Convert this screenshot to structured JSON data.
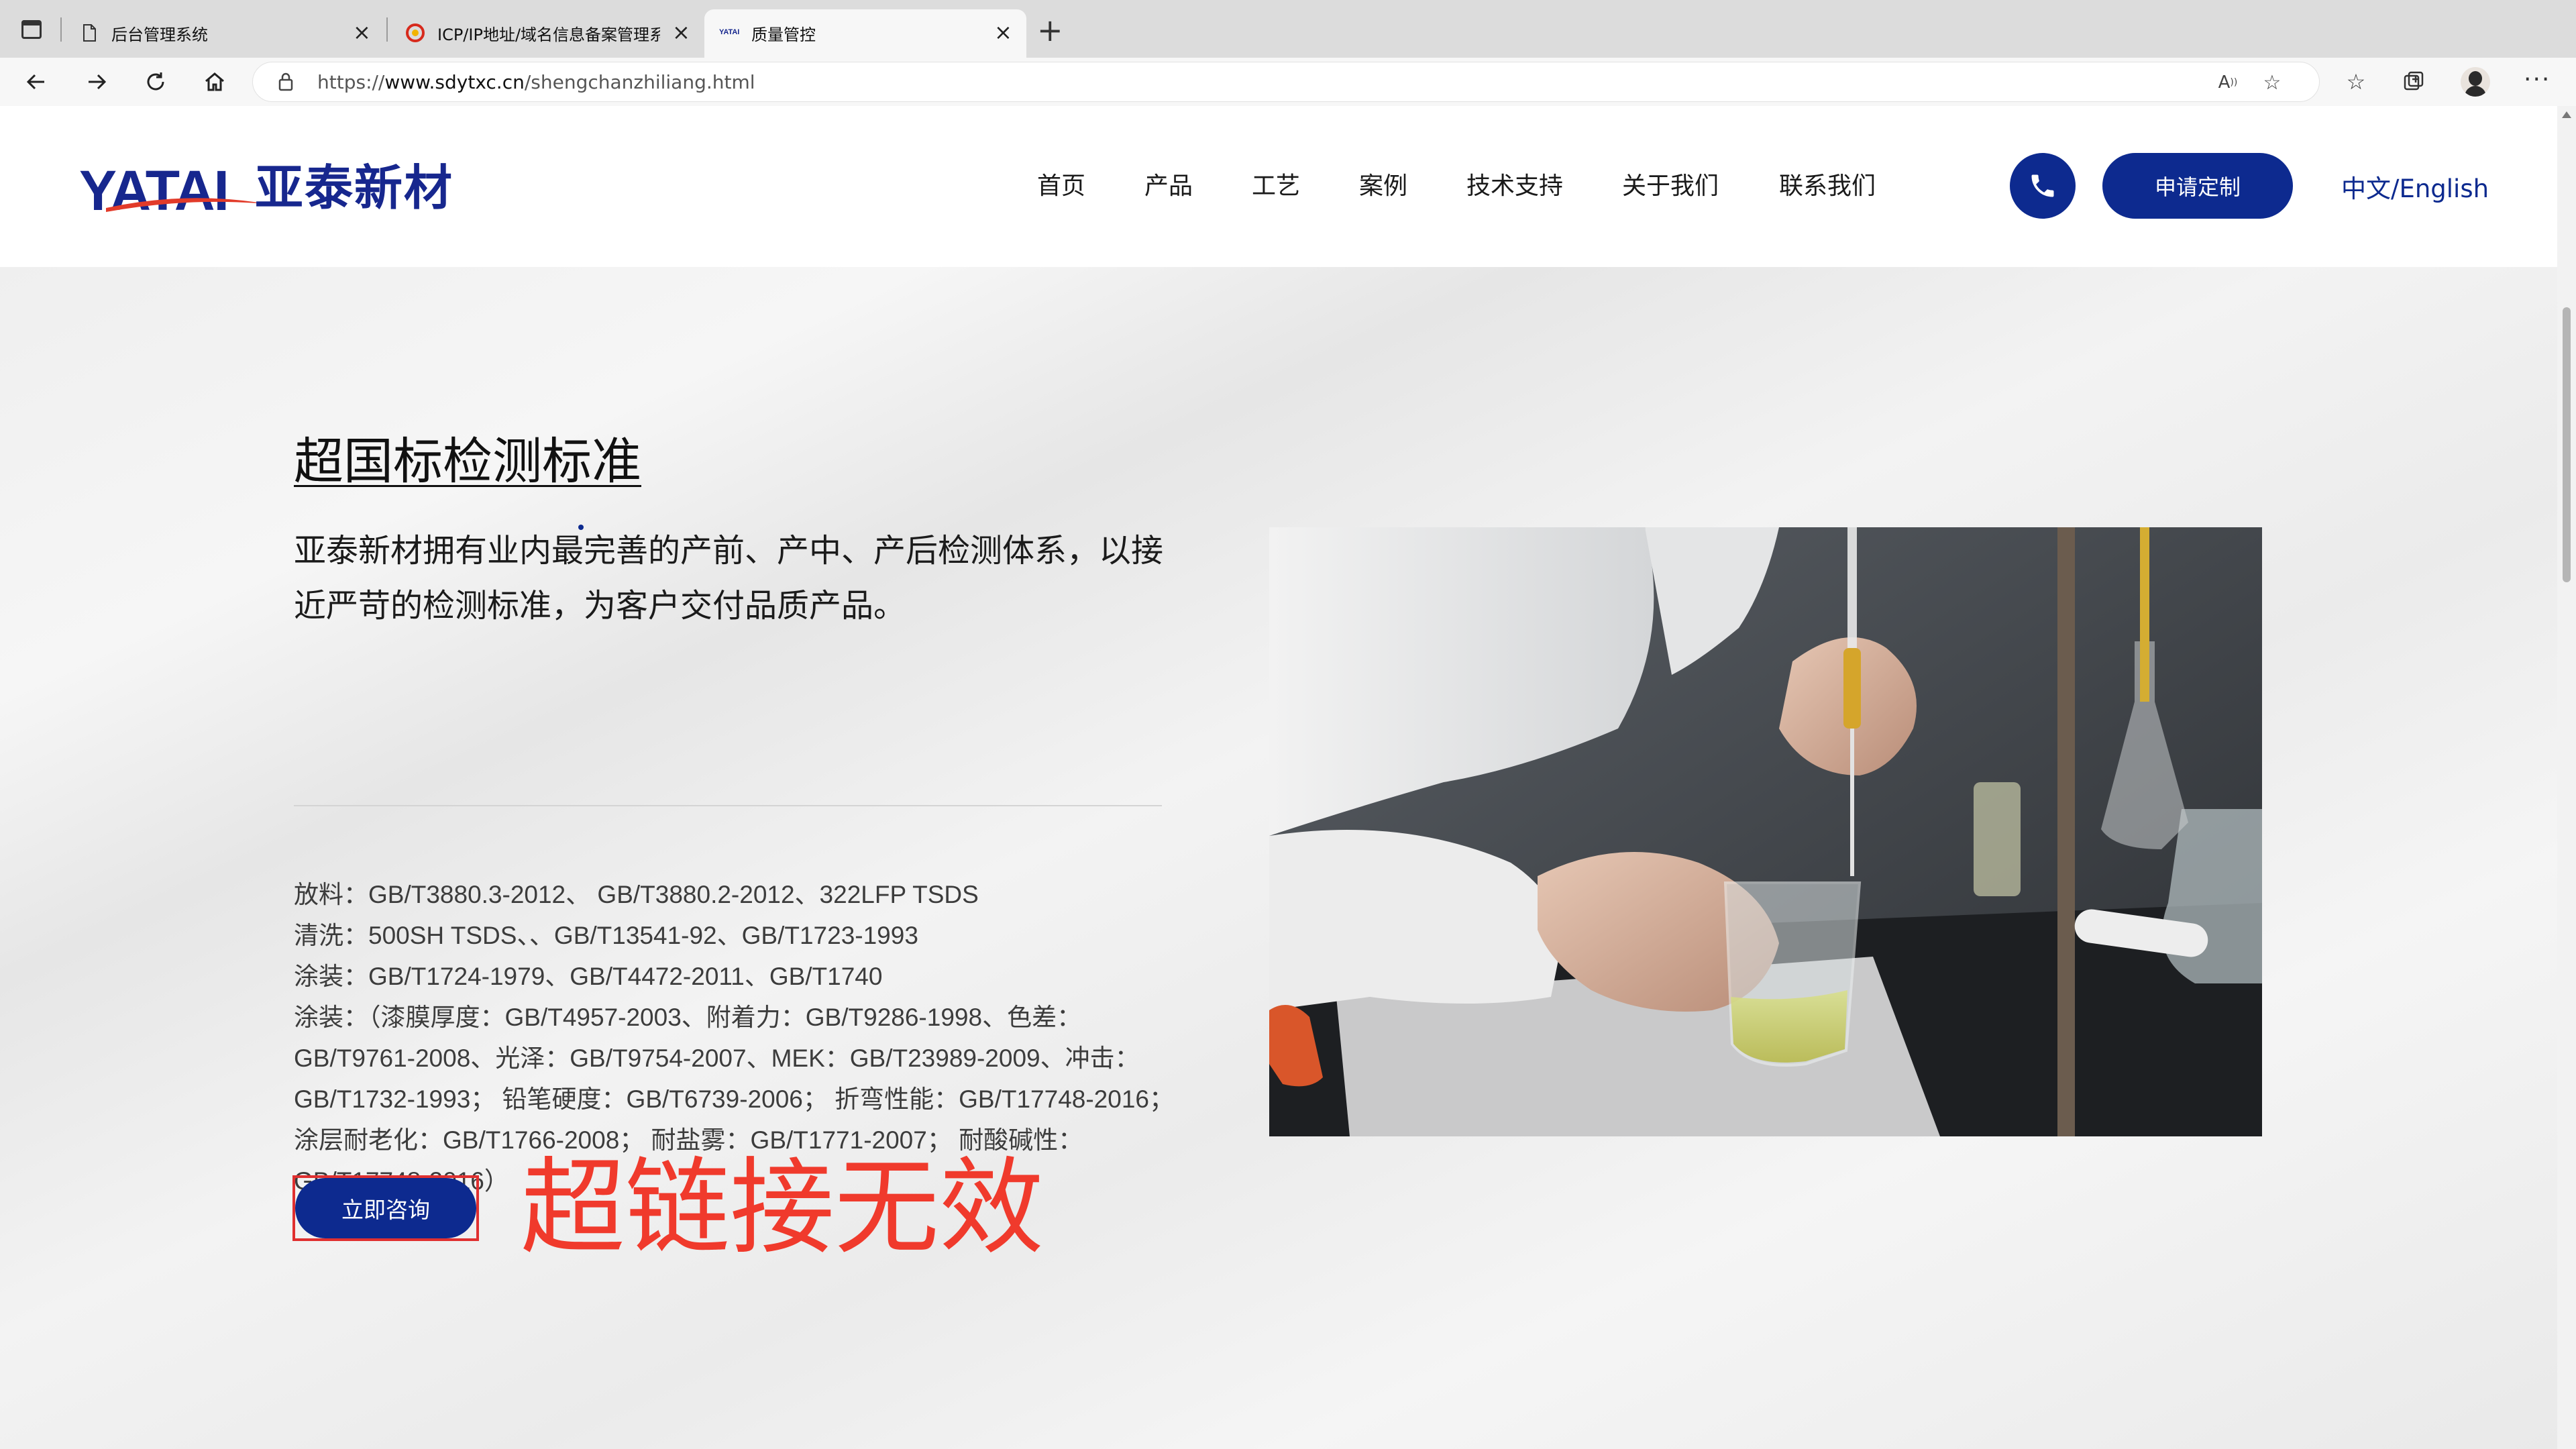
{
  "browser": {
    "tabs": [
      {
        "title": "后台管理系统",
        "active": false
      },
      {
        "title": "ICP/IP地址/域名信息备案管理系统",
        "active": false
      },
      {
        "title": "质量管控",
        "favicon_text": "YATAI",
        "active": true
      }
    ],
    "url_prefix": "https://",
    "url_domain": "www.sdytxc.cn",
    "url_path": "/shengchanzhiliang.html"
  },
  "header": {
    "logo_en": "YATAI",
    "logo_cn": "亚泰新材",
    "nav": [
      "首页",
      "产品",
      "工艺",
      "案例",
      "技术支持",
      "关于我们",
      "联系我们"
    ],
    "apply_label": "申请定制",
    "lang_label": "中文/English"
  },
  "main": {
    "title": "超国标检测标准",
    "intro": "亚泰新材拥有业内最完善的产前、产中、产后检测体系，以接近严苛的检测标准，为客户交付品质产品。",
    "standards": [
      "放料：GB/T3880.3-2012、 GB/T3880.2-2012、322LFP TSDS",
      "清洗：500SH TSDS、、GB/T13541-92、GB/T1723-1993",
      "涂装：GB/T1724-1979、GB/T4472-2011、GB/T1740",
      "涂装：（漆膜厚度：GB/T4957-2003、附着力：GB/T9286-1998、色差：",
      "GB/T9761-2008、光泽：GB/T9754-2007、MEK：GB/T23989-2009、冲击：",
      "GB/T1732-1993； 铅笔硬度：GB/T6739-2006； 折弯性能：GB/T17748-2016；",
      "涂层耐老化：GB/T1766-2008； 耐盐雾：GB/T1771-2007； 耐酸碱性：",
      "GB/T17748-2016）"
    ],
    "consult_label": "立即咨询",
    "annotation": "超链接无效"
  },
  "colors": {
    "brand_blue": "#0d2a8f",
    "annotation_red": "#f03a2c"
  }
}
